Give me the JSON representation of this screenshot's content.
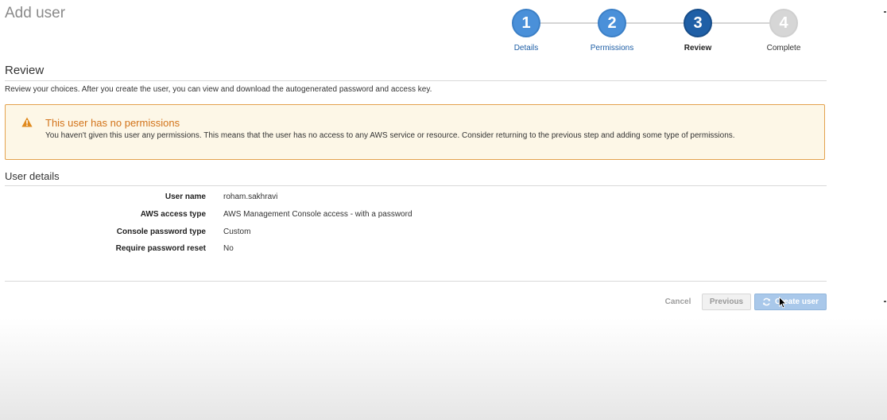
{
  "page": {
    "title": "Add user"
  },
  "stepper": {
    "steps": [
      {
        "number": "1",
        "label": "Details",
        "state": "done"
      },
      {
        "number": "2",
        "label": "Permissions",
        "state": "done"
      },
      {
        "number": "3",
        "label": "Review",
        "state": "current"
      },
      {
        "number": "4",
        "label": "Complete",
        "state": "future"
      }
    ]
  },
  "review": {
    "heading": "Review",
    "description": "Review your choices. After you create the user, you can view and download the autogenerated password and access key."
  },
  "warning": {
    "icon": "warning-triangle-icon",
    "title": "This user has no permissions",
    "message": "You haven't given this user any permissions. This means that the user has no access to any AWS service or resource. Consider returning to the previous step and adding some type of permissions."
  },
  "user_details": {
    "heading": "User details",
    "rows": [
      {
        "label": "User name",
        "value": "roham.sakhravi"
      },
      {
        "label": "AWS access type",
        "value": "AWS Management Console access - with a password"
      },
      {
        "label": "Console password type",
        "value": "Custom"
      },
      {
        "label": "Require password reset",
        "value": "No"
      }
    ]
  },
  "actions": {
    "cancel_label": "Cancel",
    "previous_label": "Previous",
    "create_label": "Create user"
  },
  "colors": {
    "step_done": "#4a90d9",
    "step_current": "#1f5fa6",
    "step_future": "#d6d6d6",
    "warning_accent": "#d2731a",
    "warning_bg": "#fdf7e7",
    "primary_button": "#a9c8ea"
  }
}
